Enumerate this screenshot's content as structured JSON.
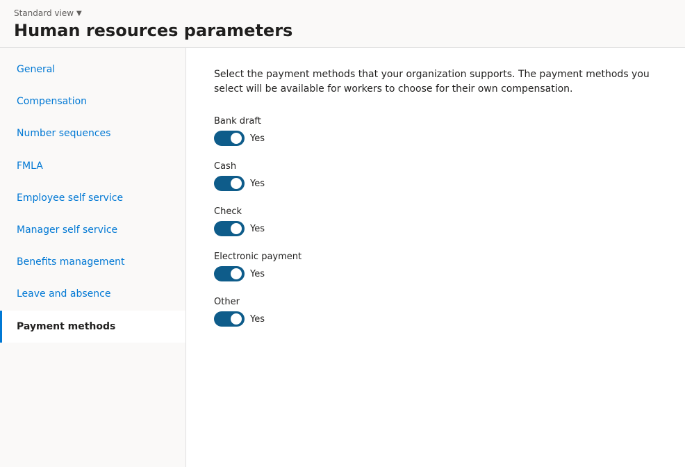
{
  "header": {
    "standard_view_label": "Standard view",
    "page_title": "Human resources parameters"
  },
  "sidebar": {
    "items": [
      {
        "id": "general",
        "label": "General",
        "active": false
      },
      {
        "id": "compensation",
        "label": "Compensation",
        "active": false
      },
      {
        "id": "number-sequences",
        "label": "Number sequences",
        "active": false
      },
      {
        "id": "fmla",
        "label": "FMLA",
        "active": false
      },
      {
        "id": "employee-self-service",
        "label": "Employee self service",
        "active": false
      },
      {
        "id": "manager-self-service",
        "label": "Manager self service",
        "active": false
      },
      {
        "id": "benefits-management",
        "label": "Benefits management",
        "active": false
      },
      {
        "id": "leave-and-absence",
        "label": "Leave and absence",
        "active": false
      },
      {
        "id": "payment-methods",
        "label": "Payment methods",
        "active": true
      }
    ]
  },
  "main": {
    "description": "Select the payment methods that your organization supports. The payment methods you select will be available for workers to choose for their own compensation.",
    "payment_methods": [
      {
        "id": "bank-draft",
        "label": "Bank draft",
        "enabled": true,
        "value_label": "Yes"
      },
      {
        "id": "cash",
        "label": "Cash",
        "enabled": true,
        "value_label": "Yes"
      },
      {
        "id": "check",
        "label": "Check",
        "enabled": true,
        "value_label": "Yes"
      },
      {
        "id": "electronic-payment",
        "label": "Electronic payment",
        "enabled": true,
        "value_label": "Yes"
      },
      {
        "id": "other",
        "label": "Other",
        "enabled": true,
        "value_label": "Yes"
      }
    ]
  }
}
